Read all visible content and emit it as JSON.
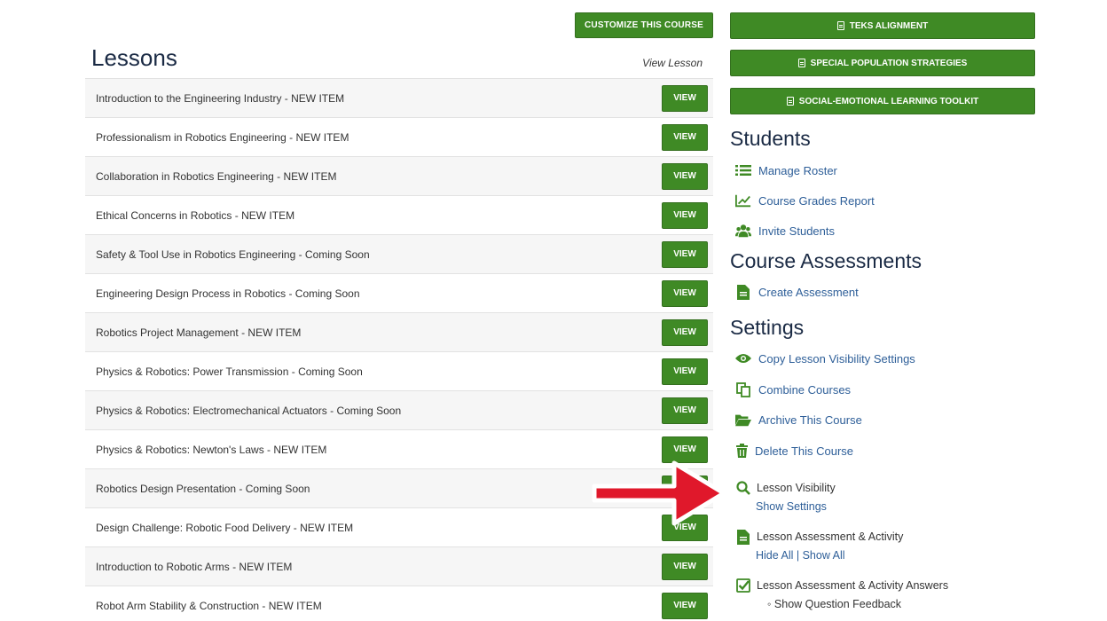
{
  "header": {
    "customize_label": "CUSTOMIZE THIS COURSE",
    "lessons_title": "Lessons",
    "view_lesson_label": "View Lesson"
  },
  "lessons": [
    {
      "name": "Introduction to the Engineering Industry - NEW ITEM",
      "button": "VIEW"
    },
    {
      "name": "Professionalism in Robotics Engineering - NEW ITEM",
      "button": "VIEW"
    },
    {
      "name": "Collaboration in Robotics Engineering - NEW ITEM",
      "button": "VIEW"
    },
    {
      "name": "Ethical Concerns in Robotics - NEW ITEM",
      "button": "VIEW"
    },
    {
      "name": "Safety & Tool Use in Robotics Engineering - Coming Soon",
      "button": "VIEW"
    },
    {
      "name": "Engineering Design Process in Robotics - Coming Soon",
      "button": "VIEW"
    },
    {
      "name": "Robotics Project Management - NEW ITEM",
      "button": "VIEW"
    },
    {
      "name": "Physics & Robotics: Power Transmission - Coming Soon",
      "button": "VIEW"
    },
    {
      "name": "Physics & Robotics: Electromechanical Actuators - Coming Soon",
      "button": "VIEW"
    },
    {
      "name": "Physics & Robotics: Newton's Laws - NEW ITEM",
      "button": "VIEW"
    },
    {
      "name": "Robotics Design Presentation - Coming Soon",
      "button": "VIEW"
    },
    {
      "name": "Design Challenge: Robotic Food Delivery - NEW ITEM",
      "button": "VIEW"
    },
    {
      "name": "Introduction to Robotic Arms - NEW ITEM",
      "button": "VIEW"
    },
    {
      "name": "Robot Arm Stability & Construction - NEW ITEM",
      "button": "VIEW"
    }
  ],
  "sidebar": {
    "teks_label": "TEKS ALIGNMENT",
    "special_label": "SPECIAL POPULATION STRATEGIES",
    "sel_label": "SOCIAL-EMOTIONAL LEARNING TOOLKIT",
    "students_title": "Students",
    "manage_roster": "Manage Roster",
    "grades_report": "Course Grades Report",
    "invite_students": "Invite Students",
    "assessments_title": "Course Assessments",
    "create_assessment": "Create Assessment",
    "settings_title": "Settings",
    "copy_visibility": "Copy Lesson Visibility Settings",
    "combine_courses": "Combine Courses",
    "archive_course": "Archive This Course",
    "delete_course": "Delete This Course",
    "lesson_visibility": "Lesson Visibility",
    "show_settings": "Show Settings",
    "assessment_activity": "Lesson Assessment & Activity",
    "hide_show_all": "Hide All | Show All",
    "assessment_answers": "Lesson Assessment & Activity Answers",
    "show_feedback": "Show Question Feedback"
  },
  "colors": {
    "accent_green": "#3f8a25",
    "link_blue": "#2d5e98",
    "arrow_red": "#e0182b"
  }
}
